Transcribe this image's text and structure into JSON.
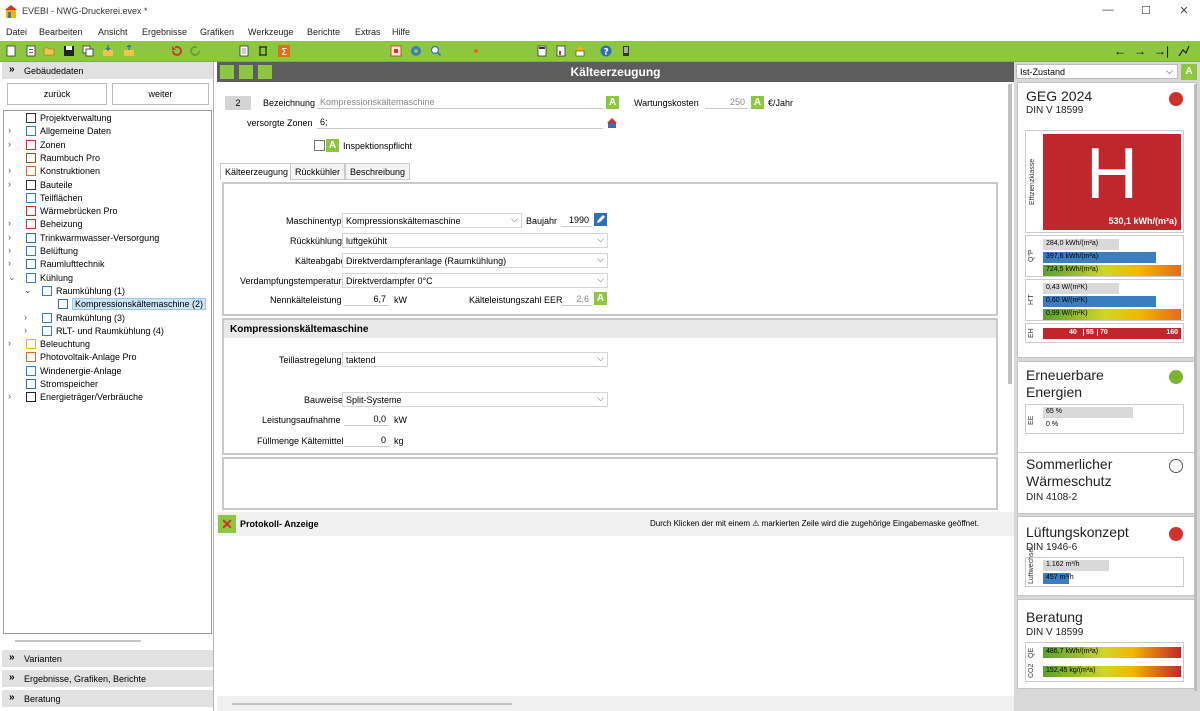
{
  "window": {
    "title": "EVEBI - NWG-Druckerei.evex *"
  },
  "menu": [
    "Datei",
    "Bearbeiten",
    "Ansicht",
    "Ergebnisse",
    "Grafiken",
    "Werkzeuge",
    "Berichte",
    "Extras",
    "Hilfe"
  ],
  "sidebar": {
    "header": "Gebäudedaten",
    "back_label": "zurück",
    "next_label": "weiter",
    "tree": [
      {
        "label": "Projektverwaltung",
        "level": 0,
        "exp": ""
      },
      {
        "label": "Allgemeine Daten",
        "level": 0,
        "exp": ">"
      },
      {
        "label": "Zonen",
        "level": 0,
        "exp": ">"
      },
      {
        "label": "Raumbuch Pro",
        "level": 0,
        "exp": ""
      },
      {
        "label": "Konstruktionen",
        "level": 0,
        "exp": ">"
      },
      {
        "label": "Bauteile",
        "level": 0,
        "exp": ">"
      },
      {
        "label": "Teilflächen",
        "level": 0,
        "exp": ""
      },
      {
        "label": "Wärmebrücken Pro",
        "level": 0,
        "exp": ""
      },
      {
        "label": "Beheizung",
        "level": 0,
        "exp": ">"
      },
      {
        "label": "Trinkwarmwasser-Versorgung",
        "level": 0,
        "exp": ">"
      },
      {
        "label": "Belüftung",
        "level": 0,
        "exp": ">"
      },
      {
        "label": "Raumlufttechnik",
        "level": 0,
        "exp": ">"
      },
      {
        "label": "Kühlung",
        "level": 0,
        "exp": "v"
      },
      {
        "label": "Raumkühlung (1)",
        "level": 1,
        "exp": "v"
      },
      {
        "label": "Kompressionskältemaschine (2)",
        "level": 2,
        "exp": "",
        "selected": true
      },
      {
        "label": "Raumkühlung (3)",
        "level": 1,
        "exp": ">"
      },
      {
        "label": "RLT- und Raumkühlung (4)",
        "level": 1,
        "exp": ">"
      },
      {
        "label": "Beleuchtung",
        "level": 0,
        "exp": ">"
      },
      {
        "label": "Photovoltaik-Anlage Pro",
        "level": 0,
        "exp": ""
      },
      {
        "label": "Windenergie-Anlage",
        "level": 0,
        "exp": ""
      },
      {
        "label": "Stromspeicher",
        "level": 0,
        "exp": ""
      },
      {
        "label": "Energieträger/Verbräuche",
        "level": 0,
        "exp": ">"
      }
    ],
    "bottom_sections": [
      "Varianten",
      "Ergebnisse, Grafiken, Berichte",
      "Beratung"
    ]
  },
  "main": {
    "title": "Kälteerzeugung",
    "index": "2",
    "bezeichnung_label": "Bezeichnung",
    "bezeichnung_value": "Kompressionskältemaschine",
    "wartung_label": "Wartungskosten",
    "wartung_value": "250",
    "wartung_unit": "€/Jahr",
    "zonen_label": "versorgte Zonen",
    "zonen_value": "6;",
    "inspektion_label": "Inspektionspflicht",
    "tabs": [
      "Kälteerzeugung",
      "Rückkühler",
      "Beschreibung"
    ],
    "form1": {
      "maschinentyp_label": "Maschinentyp",
      "maschinentyp_value": "Kompressionskältemaschine",
      "baujahr_label": "Baujahr",
      "baujahr_value": "1990",
      "rueckkuehlung_label": "Rückkühlung",
      "rueckkuehlung_value": "luftgekühlt",
      "kaelteabgabe_label": "Kälteabgabe",
      "kaelteabgabe_value": "Direktverdampferanlage (Raumkühlung)",
      "verdampfung_label": "Verdampfungstemperatur",
      "verdampfung_value": "Direktverdampfer 0°C",
      "nenn_label": "Nennkälteleistung",
      "nenn_value": "6,7",
      "nenn_unit": "kW",
      "eer_label": "Kälteleistungszahl EER",
      "eer_value": "2,6"
    },
    "section2_title": "Kompressionskältemaschine",
    "form2": {
      "teillast_label": "Teillastregelung",
      "teillast_value": "taktend",
      "bauweise_label": "Bauweise",
      "bauweise_value": "Split-Systeme",
      "leistung_label": "Leistungsaufnahme",
      "leistung_value": "0,0",
      "leistung_unit": "kW",
      "fuell_label": "Füllmenge Kältemittel",
      "fuell_value": "0",
      "fuell_unit": "kg"
    },
    "protokoll_label": "Protokoll- Anzeige",
    "protokoll_hint": "Durch Klicken der mit einem ⚠ markierten Zeile wird die zugehörige Eingabemaske geöffnet."
  },
  "right": {
    "variant": "Ist-Zustand",
    "geg": {
      "title": "GEG 2024",
      "sub": "DIN V 18599",
      "status": "#d0312d",
      "effclass_label": "Effizienzklasse",
      "effclass": "H",
      "effvalue": "530,1 kWh/(m²a)",
      "qp_label": "Q\"P",
      "qp": [
        {
          "text": "284,0 kWh/(m²a)",
          "color": "#d9d9d9",
          "fill": 0.55
        },
        {
          "text": "397,6 kWh/(m²a)",
          "color": "#3a7ebf",
          "fill": 0.82
        },
        {
          "text": "724,5 kWh/(m²a)",
          "color": "gradient",
          "fill": 1.0
        }
      ],
      "ht_label": "H'T",
      "ht": [
        {
          "text": "0,43 W/(m²K)",
          "color": "#d9d9d9",
          "fill": 0.55
        },
        {
          "text": "0,60 W/(m²K)",
          "color": "#3a7ebf",
          "fill": 0.82
        },
        {
          "text": "0,99 W/(m²K)",
          "color": "gradient",
          "fill": 1.0
        }
      ],
      "eh_label": "EH",
      "eh_values": [
        "40",
        "55",
        "70",
        "160"
      ]
    },
    "ee": {
      "title1": "Erneuerbare",
      "title2": "Energien",
      "status": "#7ab52f",
      "label": "EE",
      "bars": [
        {
          "text": "65 %",
          "fill": 0.65
        },
        {
          "text": "0 %",
          "fill": 0.0
        }
      ]
    },
    "sws": {
      "title1": "Sommerlicher",
      "title2": "Wärmeschutz",
      "sub": "DIN 4108-2"
    },
    "lk": {
      "title": "Lüftungskonzept",
      "sub": "DIN 1946-6",
      "status": "#d0312d",
      "label": "Luftwechsel",
      "bars": [
        {
          "text": "1.162 m³/h",
          "color": "#d9d9d9",
          "fill": 0.48
        },
        {
          "text": "457 m³/h",
          "color": "#3a7ebf",
          "fill": 0.19
        }
      ]
    },
    "beratung": {
      "title": "Beratung",
      "sub": "DIN V 18599",
      "qe_label": "QE",
      "qe_text": "486,7 kWh/(m²a)",
      "co2_label": "CO2",
      "co2_text": "152,45 kg/(m²a)"
    }
  }
}
